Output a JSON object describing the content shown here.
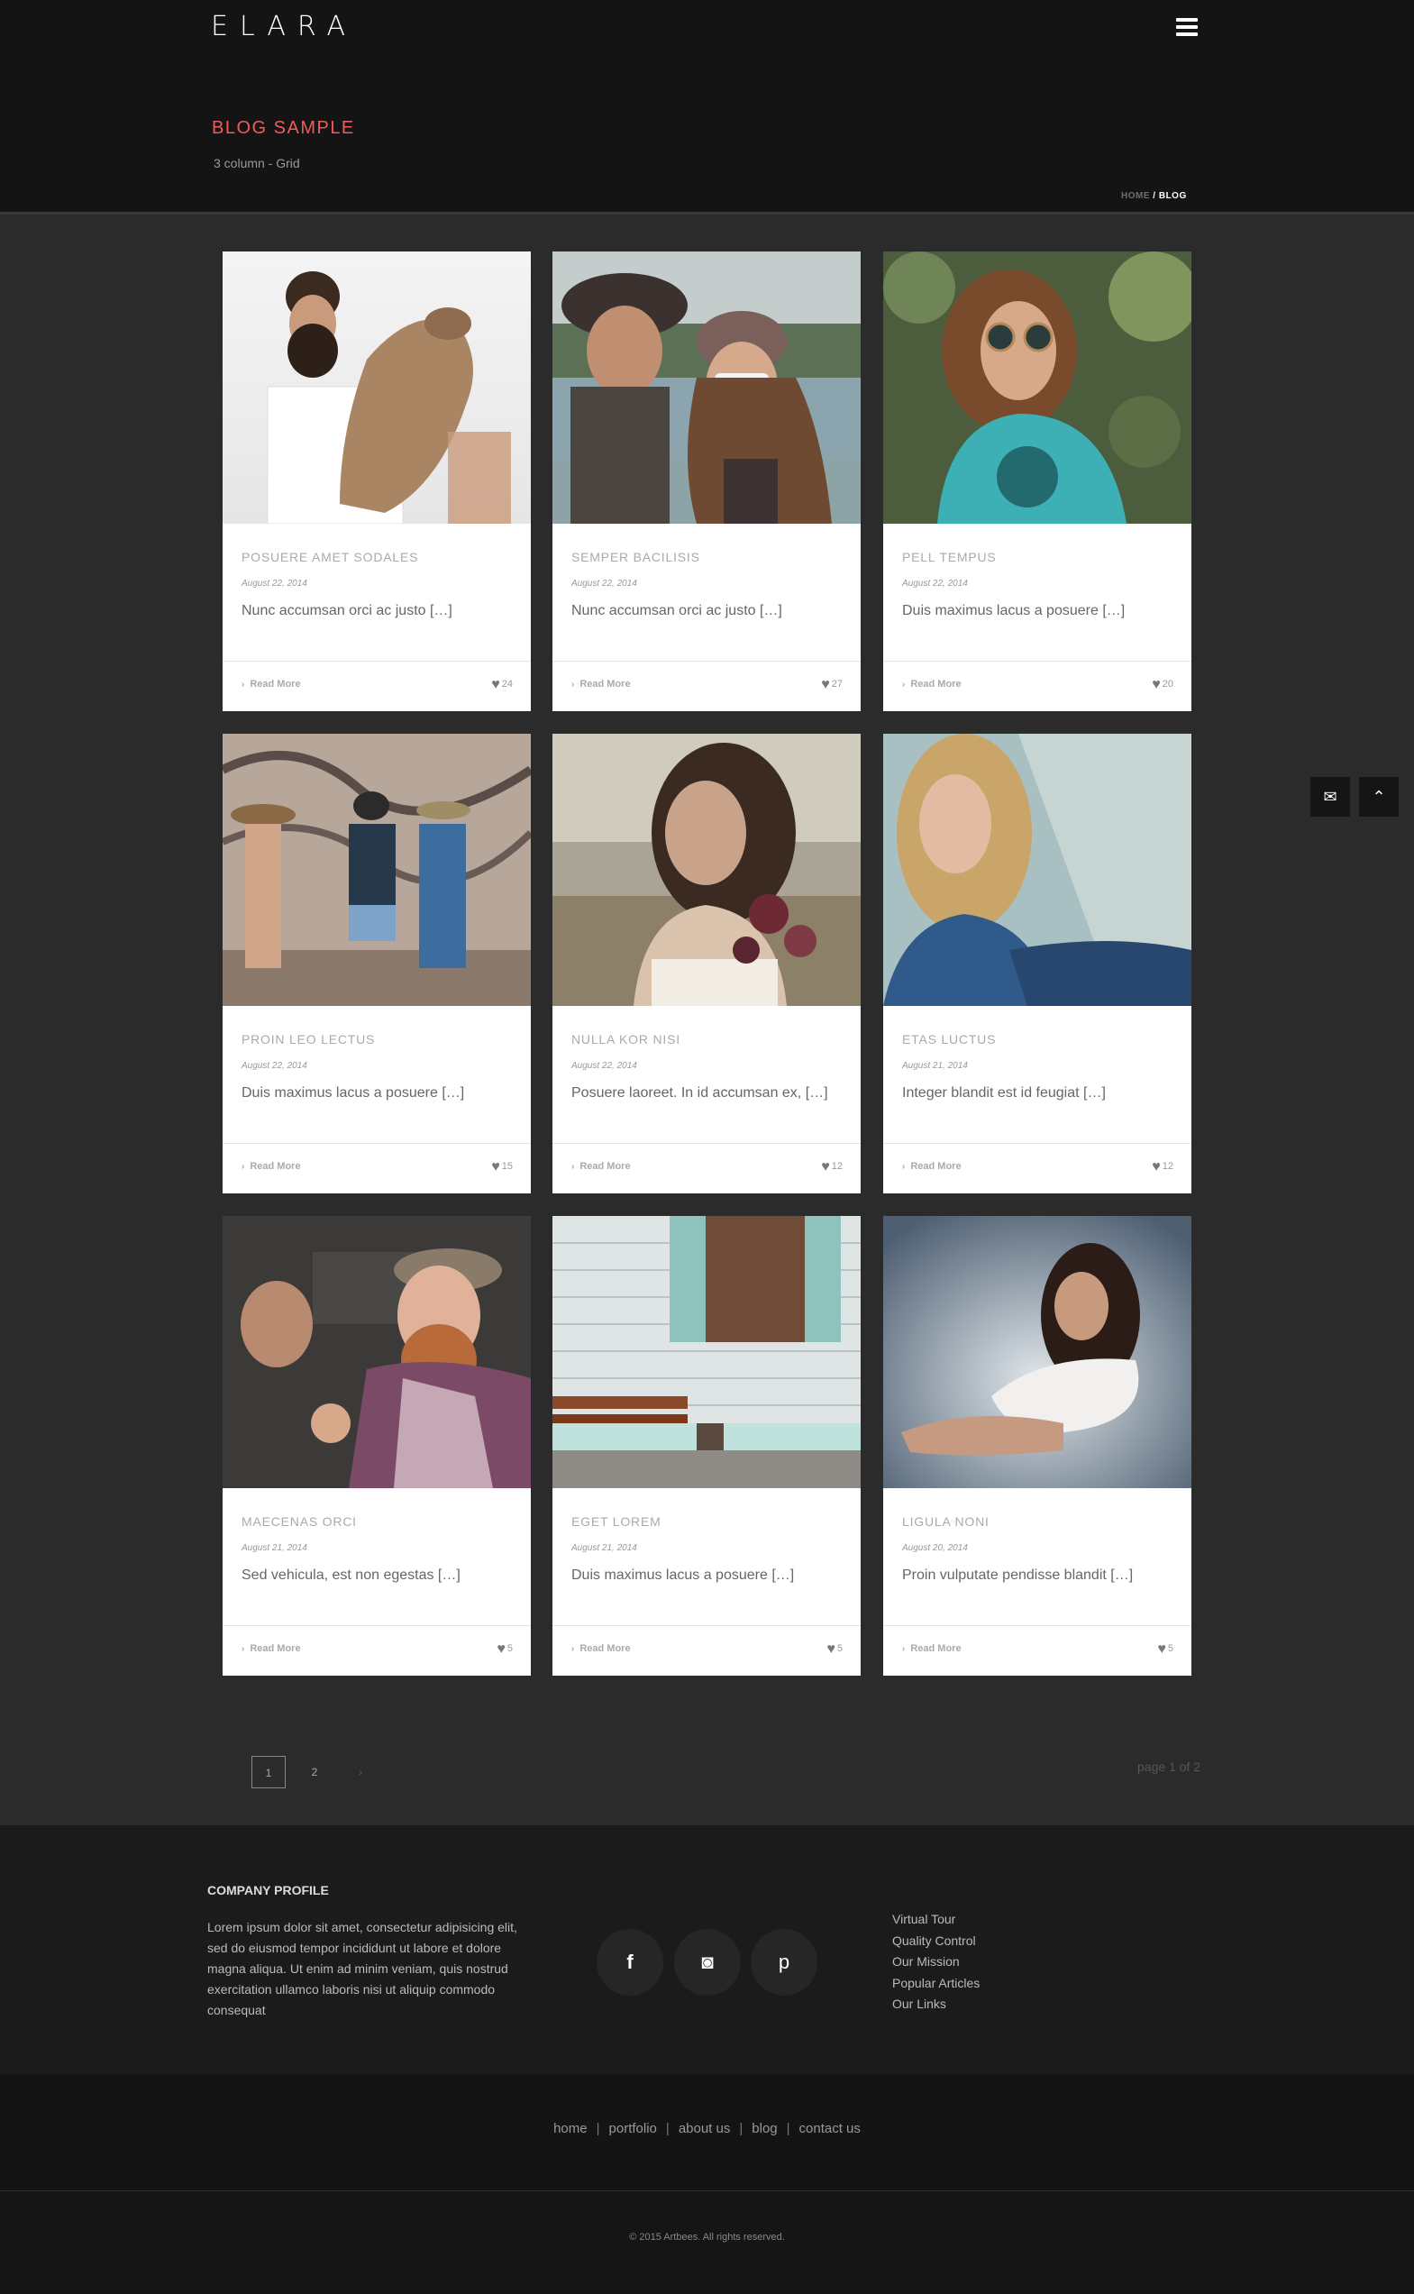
{
  "header": {
    "logo": "ELARA",
    "page_title": "BLOG SAMPLE",
    "page_subtitle": "3 column - Grid",
    "breadcrumb_home": "HOME",
    "breadcrumb_sep": " / ",
    "breadcrumb_current": "BLOG"
  },
  "posts": [
    {
      "title": "POSUERE AMET SODALES",
      "date": "August 22, 2014",
      "excerpt": "Nunc accumsan orci ac justo […]",
      "read_more": "Read More",
      "likes": "24"
    },
    {
      "title": "SEMPER BACILISIS",
      "date": "August 22, 2014",
      "excerpt": "Nunc accumsan orci ac justo […]",
      "read_more": "Read More",
      "likes": "27"
    },
    {
      "title": "PELL TEMPUS",
      "date": "August 22, 2014",
      "excerpt": "Duis maximus lacus a posuere […]",
      "read_more": "Read More",
      "likes": "20"
    },
    {
      "title": "PROIN LEO LECTUS",
      "date": "August 22, 2014",
      "excerpt": "Duis maximus lacus a posuere […]",
      "read_more": "Read More",
      "likes": "15"
    },
    {
      "title": "NULLA KOR NISI",
      "date": "August 22, 2014",
      "excerpt": "Posuere laoreet. In id accumsan ex, […]",
      "read_more": "Read More",
      "likes": "12"
    },
    {
      "title": "ETAS LUCTUS",
      "date": "August 21, 2014",
      "excerpt": "Integer blandit est id feugiat […]",
      "read_more": "Read More",
      "likes": "12"
    },
    {
      "title": "MAECENAS ORCI",
      "date": "August 21, 2014",
      "excerpt": "Sed vehicula, est non egestas […]",
      "read_more": "Read More",
      "likes": "5"
    },
    {
      "title": "EGET LOREM",
      "date": "August 21, 2014",
      "excerpt": "Duis maximus lacus a posuere […]",
      "read_more": "Read More",
      "likes": "5"
    },
    {
      "title": "LIGULA NONI",
      "date": "August 20, 2014",
      "excerpt": "Proin vulputate pendisse blandit […]",
      "read_more": "Read More",
      "likes": "5"
    }
  ],
  "pagination": {
    "pages": [
      "1",
      "2"
    ],
    "next": "›",
    "info": "page 1 of 2",
    "current": 1
  },
  "footer": {
    "company_title": "COMPANY PROFILE",
    "company_text": "Lorem ipsum dolor sit amet, consectetur adipisicing elit, sed do eiusmod tempor incididunt ut labore et dolore magna aliqua. Ut enim ad minim veniam, quis nostrud exercitation ullamco laboris nisi ut aliquip commodo consequat",
    "social": [
      {
        "icon": "facebook-icon",
        "glyph": "f"
      },
      {
        "icon": "instagram-icon",
        "glyph": "◙"
      },
      {
        "icon": "pinterest-icon",
        "glyph": "p"
      }
    ],
    "links": [
      "Virtual Tour",
      "Quality Control",
      "Our Mission",
      "Popular Articles",
      "Our Links"
    ],
    "nav": [
      "home",
      "portfolio",
      "about us",
      "blog",
      "contact us"
    ],
    "copyright": "© 2015 Artbees. All rights reserved."
  },
  "colors": {
    "accent": "#f25a5a",
    "header_bg": "#141414",
    "body_bg": "#2b2b2b"
  }
}
